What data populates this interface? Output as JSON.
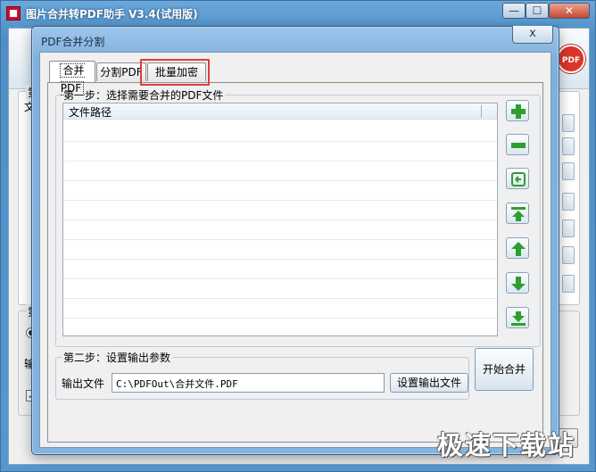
{
  "main_window": {
    "title": "图片合并转PDF助手 V3.4(试用版)",
    "min_label": "—",
    "max_label": "☐",
    "close_label": "✕",
    "logo_text": "PDF",
    "group1_label": "第",
    "group1_col": "文",
    "group2_label": "第",
    "output_label": "输",
    "bottom_btn": "1"
  },
  "dialog": {
    "title": "PDF合并分割",
    "close_label": "x",
    "tabs": [
      {
        "label": "合并PDF",
        "active": true
      },
      {
        "label": "分割PDF",
        "active": false
      },
      {
        "label": "批量加密",
        "active": false,
        "highlighted": true
      }
    ],
    "step1": {
      "label": "第一步：选择需要合并的PDF文件",
      "column_header": "文件路径",
      "side_buttons": [
        {
          "name": "add-file-button",
          "icon": "plus-icon"
        },
        {
          "name": "remove-file-button",
          "icon": "minus-icon"
        },
        {
          "name": "clear-list-button",
          "icon": "refresh-icon"
        },
        {
          "name": "move-top-button",
          "icon": "arrow-top-icon"
        },
        {
          "name": "move-up-button",
          "icon": "arrow-up-icon"
        },
        {
          "name": "move-down-button",
          "icon": "arrow-down-icon"
        },
        {
          "name": "move-bottom-button",
          "icon": "arrow-bottom-icon"
        }
      ]
    },
    "step2": {
      "label": "第二步：设置输出参数",
      "output_label": "输出文件",
      "output_value": "C:\\PDFOut\\合并文件.PDF",
      "set_output_button": "设置输出文件"
    },
    "start_button": "开始合并"
  },
  "watermark": "极速下载站",
  "colors": {
    "titlebar": "#5597cf",
    "dialog_frame": "#82b4e0",
    "icon_green": "#2e9e2e",
    "highlight_red": "#e03c3c"
  }
}
